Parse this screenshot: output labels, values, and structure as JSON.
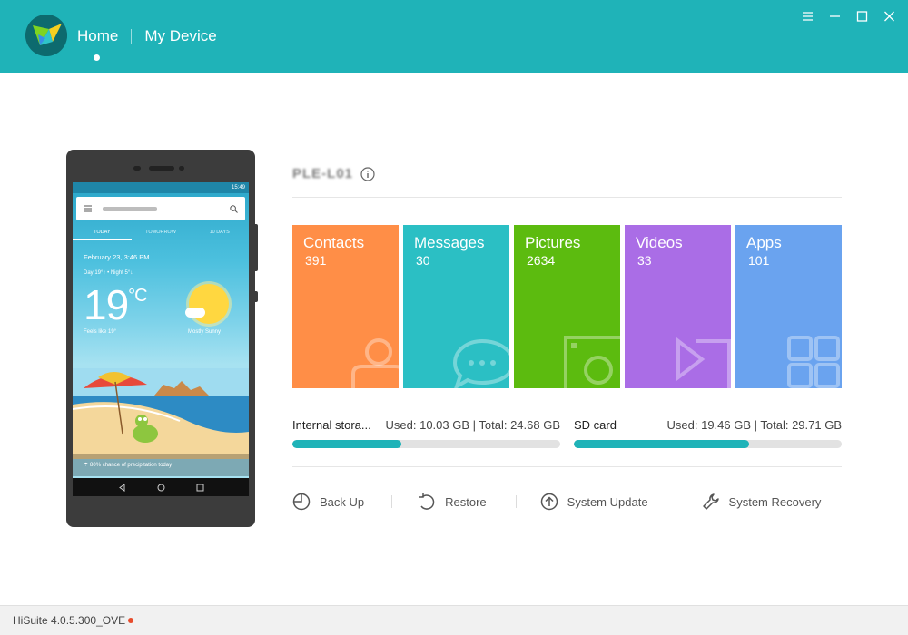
{
  "header": {
    "nav": [
      {
        "label": "Home",
        "active": true
      },
      {
        "label": "My Device",
        "active": false
      }
    ],
    "window_controls": [
      "menu-icon",
      "minimize-icon",
      "maximize-icon",
      "close-icon"
    ],
    "brand_color": "#1fb3b8"
  },
  "phone_screen": {
    "status_time": "15:49",
    "tabs": [
      "TODAY",
      "TOMORROW",
      "10 DAYS"
    ],
    "date": "February 23, 3:46 PM",
    "range": "Day 19°↑ • Night 5°↓",
    "temperature": "19",
    "unit": "°C",
    "feels_like": "Feels like 19°",
    "condition": "Mostly Sunny",
    "precipitation": "80% chance of precipitation today"
  },
  "device": {
    "name": "PLE-L01"
  },
  "tiles": [
    {
      "name": "Contacts",
      "count": "391",
      "color": "#ff8e47",
      "icon": "contact-icon"
    },
    {
      "name": "Messages",
      "count": "30",
      "color": "#2bbfc4",
      "icon": "message-icon"
    },
    {
      "name": "Pictures",
      "count": "2634",
      "color": "#5cbb0f",
      "icon": "picture-icon"
    },
    {
      "name": "Videos",
      "count": "33",
      "color": "#aa6de6",
      "icon": "video-icon"
    },
    {
      "name": "Apps",
      "count": "101",
      "color": "#6aa3ef",
      "icon": "apps-icon"
    }
  ],
  "storage": [
    {
      "label": "Internal stora...",
      "used": "Used: 10.03 GB | Total: 24.68 GB",
      "fraction": 0.4064
    },
    {
      "label": "SD card",
      "used": "Used: 19.46 GB | Total: 29.71 GB",
      "fraction": 0.655
    }
  ],
  "actions": [
    {
      "label": "Back Up",
      "icon": "backup-icon"
    },
    {
      "label": "Restore",
      "icon": "restore-icon"
    },
    {
      "label": "System Update",
      "icon": "system-update-icon"
    },
    {
      "label": "System Recovery",
      "icon": "wrench-icon"
    }
  ],
  "footer": {
    "version": "HiSuite 4.0.5.300_OVE"
  }
}
